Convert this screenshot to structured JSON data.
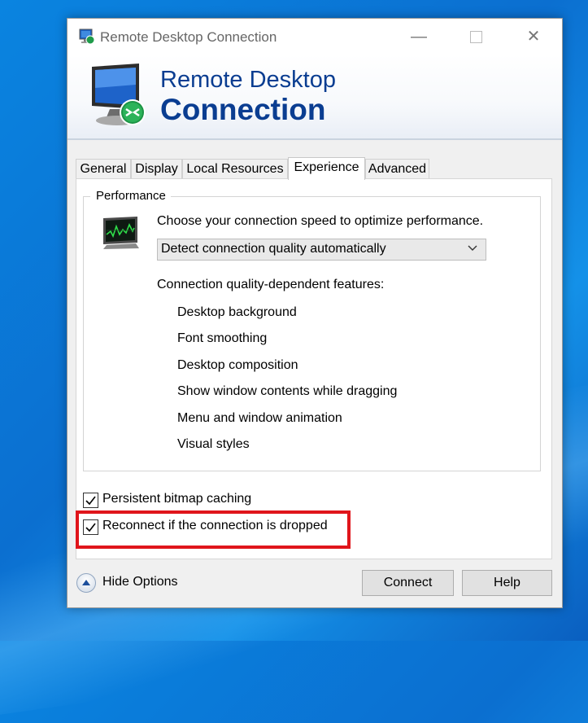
{
  "window": {
    "title": "Remote Desktop Connection",
    "controls": {
      "minimize": "—",
      "close": "✕"
    }
  },
  "banner": {
    "line1": "Remote Desktop",
    "line2": "Connection"
  },
  "tabs": [
    {
      "label": "General",
      "active": false
    },
    {
      "label": "Display",
      "active": false
    },
    {
      "label": "Local Resources",
      "active": false
    },
    {
      "label": "Experience",
      "active": true
    },
    {
      "label": "Advanced",
      "active": false
    }
  ],
  "performance": {
    "group_label": "Performance",
    "speed_label": "Choose your connection speed to optimize performance.",
    "speed_selected": "Detect connection quality automatically",
    "features_label": "Connection quality-dependent features:",
    "features": [
      "Desktop background",
      "Font smoothing",
      "Desktop composition",
      "Show window contents while dragging",
      "Menu and window animation",
      "Visual styles"
    ]
  },
  "options": {
    "persistent_bitmap_caching": {
      "label": "Persistent bitmap caching",
      "checked": true
    },
    "reconnect_if_dropped": {
      "label": "Reconnect if the connection is dropped",
      "checked": true
    }
  },
  "footer": {
    "hide_options": "Hide Options",
    "connect": "Connect",
    "help": "Help"
  },
  "colors": {
    "banner_text": "#0a3d91",
    "highlight_box": "#e0151b",
    "desktop_blue": "#0b6fd0"
  },
  "icons": {
    "app": "remote-desktop-icon",
    "banner": "remote-desktop-monitor-icon",
    "performance": "performance-monitor-icon",
    "dropdown": "chevron-down-icon",
    "hide_options": "chevron-up-circle-icon",
    "checkbox": "checkmark-icon"
  }
}
